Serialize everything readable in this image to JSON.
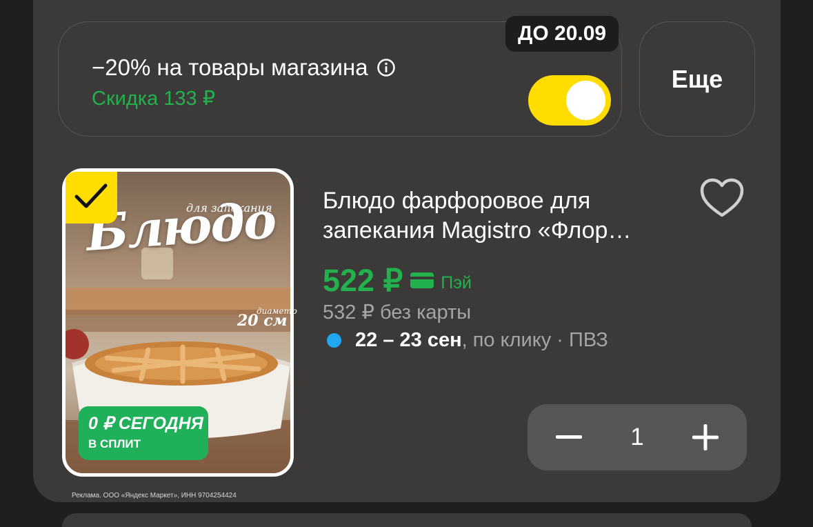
{
  "promo": {
    "title": "−20% на товары магазина",
    "discount": "Скидка 133 ₽",
    "deadline": "ДО 20.09",
    "toggle_on": true,
    "more_label": "Еще"
  },
  "product": {
    "image_texts": {
      "purpose": "для запекания",
      "word": "Блюдо",
      "diameter_label": "диаметр",
      "diameter_value": "20 см"
    },
    "split_badge": {
      "main": "0 ₽ СЕГОДНЯ",
      "sub": "В СПЛИТ"
    },
    "title_line1": "Блюдо фарфоровое для",
    "title_line2": "запекания Magistro «Флор…",
    "price": "522 ₽",
    "pay_label": "Пэй",
    "old_price": "532 ₽  без карты",
    "delivery": {
      "date": "22 – 23 сен",
      "rest": ", по клику · ПВЗ"
    },
    "quantity": "1",
    "selected": true,
    "favorite": false
  },
  "ad_disclaimer": "Реклама. ООО «Яндекс Маркет», ИНН 9704254424",
  "colors": {
    "accent_yellow": "#ffdd00",
    "price_green": "#22b14c",
    "delivery_dot": "#21a7f0",
    "card_bg": "#3b3a39"
  },
  "icons": [
    "info-icon",
    "checkmark-icon",
    "heart-icon",
    "card-icon",
    "minus-icon",
    "plus-icon"
  ]
}
